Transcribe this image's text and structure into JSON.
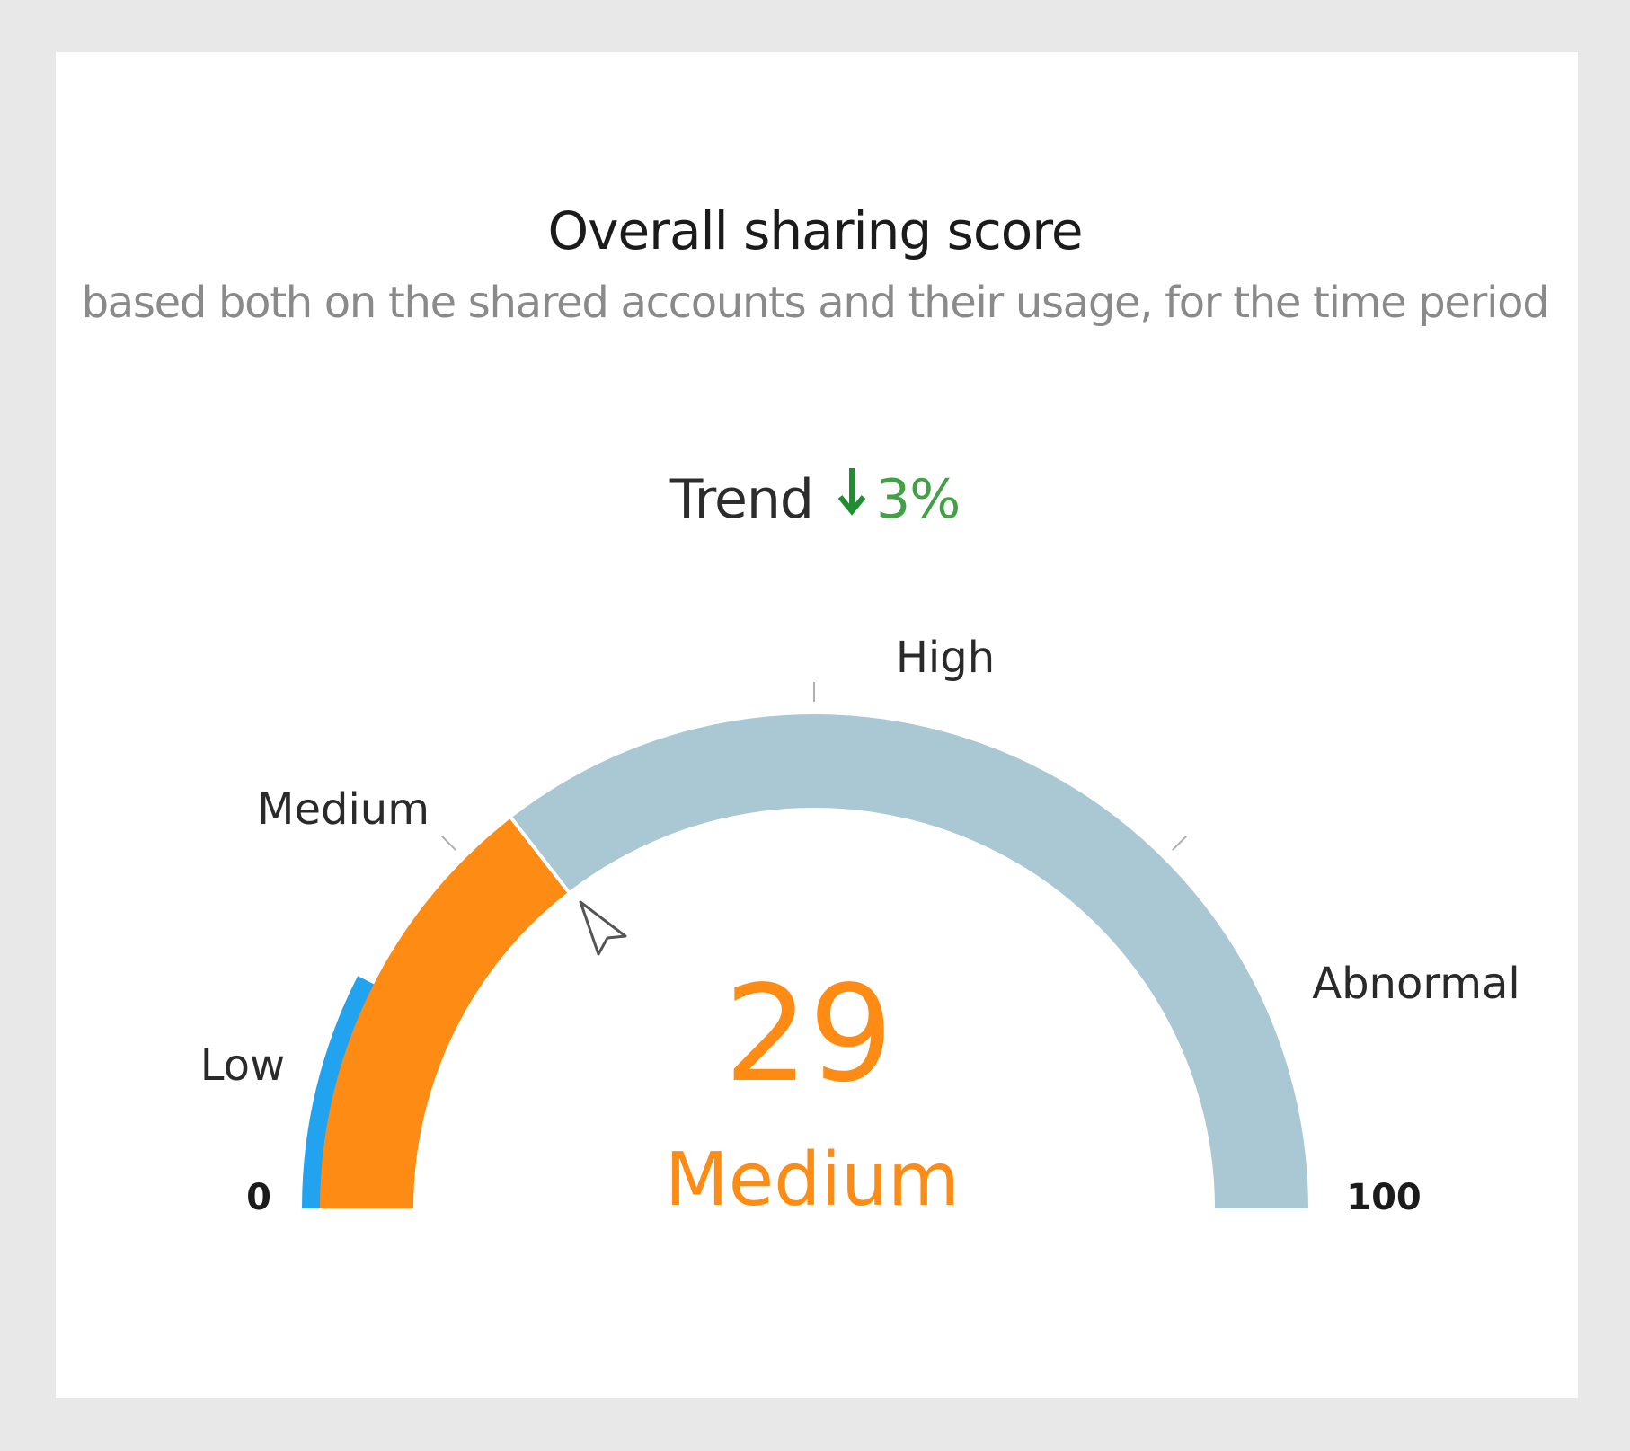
{
  "card": {
    "title": "Overall sharing score",
    "subtitle": "based both on the shared accounts and their usage, for the time period"
  },
  "trend": {
    "label": "Trend",
    "direction": "down",
    "value": "3%",
    "arrow_icon": "arrow-down-icon",
    "color": "#43a047"
  },
  "chart_data": {
    "type": "gauge",
    "min": 0,
    "max": 100,
    "min_label": "0",
    "max_label": "100",
    "value": 29,
    "value_label": "29",
    "level_label": "Medium",
    "bands": [
      {
        "name": "Low",
        "from": 0,
        "to": 25
      },
      {
        "name": "Medium",
        "from": 25,
        "to": 50
      },
      {
        "name": "High",
        "from": 50,
        "to": 75
      },
      {
        "name": "Abnormal",
        "from": 75,
        "to": 100
      }
    ],
    "low_indicator_value": 15,
    "colors": {
      "value_arc": "#fe8c14",
      "remaining_arc": "#aac8d4",
      "low_arc": "#22a3f0",
      "value_text": "#fe8c14",
      "band_label": "#2a2a2a",
      "tick": "#b0b0b0"
    }
  },
  "cursor": {
    "icon": "mouse-pointer-icon"
  }
}
